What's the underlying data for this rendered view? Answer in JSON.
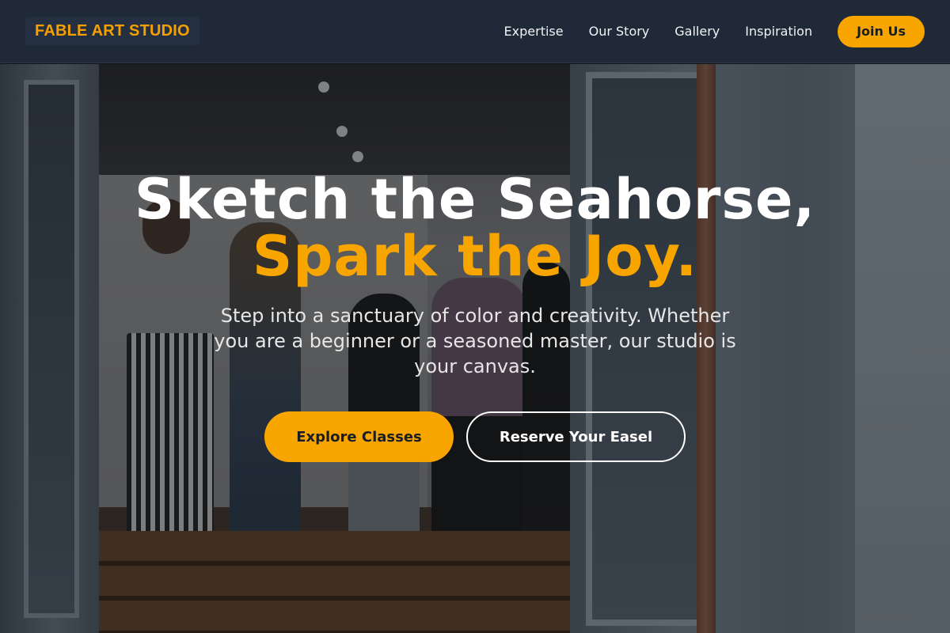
{
  "header": {
    "logo": "FABLE ART STUDIO",
    "nav": [
      {
        "label": "Expertise"
      },
      {
        "label": "Our Story"
      },
      {
        "label": "Gallery"
      },
      {
        "label": "Inspiration"
      }
    ],
    "cta_label": "Join Us"
  },
  "hero": {
    "headline_line1": "Sketch the Seahorse,",
    "headline_line2": "Spark the Joy.",
    "subtitle": "Step into a sanctuary of color and creativity. Whether you are a beginner or a seasoned master, our studio is your canvas.",
    "primary_cta": "Explore Classes",
    "secondary_cta": "Reserve Your Easel"
  },
  "colors": {
    "accent": "#f8a500",
    "header_bg": "#1f2937",
    "text_light": "#ffffff"
  }
}
